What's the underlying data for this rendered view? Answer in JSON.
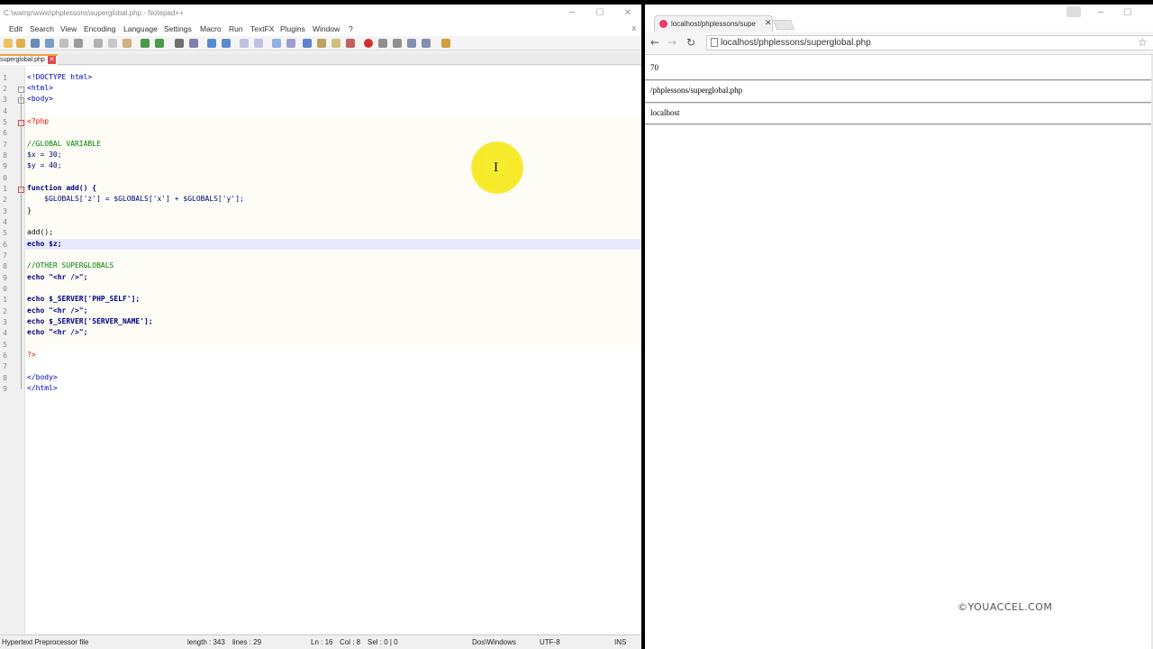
{
  "notepad": {
    "title": "C:\\wamp\\www\\phplessons\\superglobal.php - Notepad++",
    "window_controls": {
      "minimize": "─",
      "maximize": "☐",
      "close": "✕"
    },
    "menu": [
      "Edit",
      "Search",
      "View",
      "Encoding",
      "Language",
      "Settings",
      "Macro",
      "Run",
      "TextFX",
      "Plugins",
      "Window",
      "?"
    ],
    "menu_close": "x",
    "tab": {
      "label": "superglobal.php",
      "close": "✕"
    },
    "code_lines": [
      "<!DOCTYPE html>",
      "<html>",
      "<body>",
      "",
      "<?php",
      "",
      "//GLOBAL VARIABLE",
      "$x = 30;",
      "$y = 40;",
      "",
      "function add() {",
      "    $GLOBALS['z'] = $GLOBALS['x'] + $GLOBALS['y'];",
      "}",
      "",
      "add();",
      "echo $z;",
      "",
      "//OTHER SUPERGLOBALS",
      "echo \"<hr />\";",
      "",
      "echo $_SERVER['PHP_SELF'];",
      "echo \"<hr />\";",
      "echo $_SERVER['SERVER_NAME'];",
      "echo \"<hr />\";",
      "",
      "?>",
      "",
      "</body>",
      "</html>"
    ],
    "line_numbers": [
      "1",
      "2",
      "3",
      "4",
      "5",
      "6",
      "7",
      "8",
      "9",
      "0",
      "1",
      "2",
      "3",
      "4",
      "5",
      "6",
      "7",
      "8",
      "9",
      "0",
      "1",
      "2",
      "3",
      "4",
      "5",
      "6",
      "7",
      "8",
      "9"
    ],
    "status": {
      "file_type": "Hypertext Preprocessor file",
      "length": "length : 343",
      "lines": "lines : 29",
      "position": "Ln : 16",
      "col": "Col : 8",
      "sel": "Sel : 0 | 0",
      "eol": "Dos\\Windows",
      "encoding": "UTF-8",
      "mode": "INS"
    },
    "cursor_icon": "I"
  },
  "browser": {
    "tab_title": "localhost/phplessons/superglobal.php",
    "tab_close": "✕",
    "window_controls": {
      "minimize": "─",
      "maximize": "☐"
    },
    "nav": {
      "back": "←",
      "forward": "→",
      "reload": "↻"
    },
    "url": "localhost/phplessons/superglobal.php",
    "bookmark": "☆",
    "output": [
      "70",
      "/phplessons/superglobal.php",
      "localhost"
    ],
    "watermark": "©YOUACCEL.COM"
  },
  "colors": {
    "cursor_highlight": "#f6ea2a",
    "tab_accent": "#f4a040",
    "favicon": "#e8396a"
  }
}
